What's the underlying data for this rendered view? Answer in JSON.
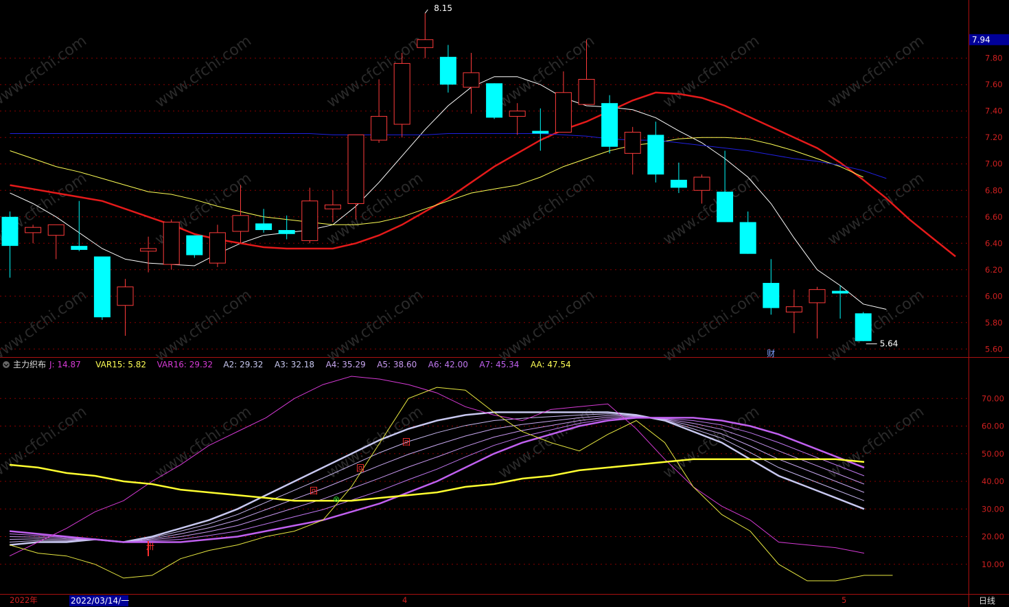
{
  "chart_data": {
    "type": "candlestick",
    "price_axis": {
      "ticks": [
        "7.80",
        "7.60",
        "7.40",
        "7.20",
        "7.00",
        "6.80",
        "6.60",
        "6.40",
        "6.20",
        "6.00",
        "5.80",
        "5.60"
      ],
      "current_price_label": "7.94",
      "ylim": [
        5.56,
        8.24
      ]
    },
    "candles": [
      {
        "o": 6.6,
        "h": 6.64,
        "l": 6.14,
        "c": 6.38
      },
      {
        "o": 6.48,
        "h": 6.54,
        "l": 6.4,
        "c": 6.52
      },
      {
        "o": 6.46,
        "h": 6.54,
        "l": 6.28,
        "c": 6.54
      },
      {
        "o": 6.38,
        "h": 6.72,
        "l": 6.34,
        "c": 6.35
      },
      {
        "o": 6.3,
        "h": 6.3,
        "l": 5.82,
        "c": 5.84
      },
      {
        "o": 5.93,
        "h": 6.13,
        "l": 5.7,
        "c": 6.07
      },
      {
        "o": 6.34,
        "h": 6.45,
        "l": 6.18,
        "c": 6.36
      },
      {
        "o": 6.24,
        "h": 6.58,
        "l": 6.2,
        "c": 6.56
      },
      {
        "o": 6.46,
        "h": 6.46,
        "l": 6.29,
        "c": 6.31
      },
      {
        "o": 6.25,
        "h": 6.54,
        "l": 6.22,
        "c": 6.48
      },
      {
        "o": 6.49,
        "h": 6.84,
        "l": 6.4,
        "c": 6.61
      },
      {
        "o": 6.55,
        "h": 6.66,
        "l": 6.48,
        "c": 6.5
      },
      {
        "o": 6.5,
        "h": 6.61,
        "l": 6.43,
        "c": 6.47
      },
      {
        "o": 6.42,
        "h": 6.82,
        "l": 6.4,
        "c": 6.72
      },
      {
        "o": 6.66,
        "h": 6.8,
        "l": 6.56,
        "c": 6.69
      },
      {
        "o": 6.7,
        "h": 7.22,
        "l": 6.58,
        "c": 7.22
      },
      {
        "o": 7.18,
        "h": 7.64,
        "l": 7.16,
        "c": 7.36
      },
      {
        "o": 7.3,
        "h": 7.84,
        "l": 7.2,
        "c": 7.76
      },
      {
        "o": 7.88,
        "h": 8.14,
        "l": 7.8,
        "c": 7.94
      },
      {
        "o": 7.81,
        "h": 7.9,
        "l": 7.54,
        "c": 7.6
      },
      {
        "o": 7.58,
        "h": 7.84,
        "l": 7.38,
        "c": 7.69
      },
      {
        "o": 7.61,
        "h": 7.61,
        "l": 7.34,
        "c": 7.35
      },
      {
        "o": 7.36,
        "h": 7.46,
        "l": 7.22,
        "c": 7.4
      },
      {
        "o": 7.25,
        "h": 7.42,
        "l": 7.1,
        "c": 7.23
      },
      {
        "o": 7.24,
        "h": 7.7,
        "l": 7.24,
        "c": 7.54
      },
      {
        "o": 7.45,
        "h": 7.94,
        "l": 7.45,
        "c": 7.64
      },
      {
        "o": 7.46,
        "h": 7.52,
        "l": 7.08,
        "c": 7.13
      },
      {
        "o": 7.08,
        "h": 7.28,
        "l": 6.92,
        "c": 7.24
      },
      {
        "o": 7.22,
        "h": 7.32,
        "l": 6.86,
        "c": 6.92
      },
      {
        "o": 6.88,
        "h": 7.01,
        "l": 6.78,
        "c": 6.82
      },
      {
        "o": 6.8,
        "h": 6.92,
        "l": 6.7,
        "c": 6.9
      },
      {
        "o": 6.79,
        "h": 7.1,
        "l": 6.56,
        "c": 6.56
      },
      {
        "o": 6.56,
        "h": 6.64,
        "l": 6.32,
        "c": 6.32
      },
      {
        "o": 6.1,
        "h": 6.28,
        "l": 5.86,
        "c": 5.91
      },
      {
        "o": 5.88,
        "h": 6.05,
        "l": 5.72,
        "c": 5.92
      },
      {
        "o": 5.95,
        "h": 6.07,
        "l": 5.68,
        "c": 6.05
      },
      {
        "o": 6.04,
        "h": 6.08,
        "l": 5.83,
        "c": 6.02
      },
      {
        "o": 5.87,
        "h": 5.88,
        "l": 5.66,
        "c": 5.66
      }
    ],
    "price_lines": [
      {
        "color": "#ffffff",
        "width": 1,
        "start": 0,
        "values": [
          6.78,
          6.7,
          6.6,
          6.48,
          6.36,
          6.28,
          6.25,
          6.24,
          6.23,
          6.32,
          6.4,
          6.46,
          6.48,
          6.5,
          6.54,
          6.68,
          6.86,
          7.06,
          7.26,
          7.44,
          7.58,
          7.66,
          7.66,
          7.6,
          7.5,
          7.44,
          7.43,
          7.41,
          7.35,
          7.25,
          7.16,
          7.04,
          6.9,
          6.7,
          6.44,
          6.2,
          6.08,
          5.94,
          5.9
        ]
      },
      {
        "color": "#e51a1a",
        "width": 2.5,
        "start": 0,
        "values": [
          6.84,
          6.81,
          6.78,
          6.75,
          6.72,
          6.66,
          6.6,
          6.54,
          6.47,
          6.43,
          6.4,
          6.37,
          6.36,
          6.36,
          6.36,
          6.4,
          6.46,
          6.54,
          6.64,
          6.74,
          6.86,
          6.98,
          7.08,
          7.18,
          7.26,
          7.32,
          7.4,
          7.48,
          7.54,
          7.53,
          7.5,
          7.44,
          7.36,
          7.28,
          7.2,
          7.12,
          7.01,
          6.88,
          6.74,
          6.58,
          6.44,
          6.3
        ]
      },
      {
        "color": "#ffff55",
        "width": 1,
        "start": 0,
        "values": [
          7.1,
          7.04,
          6.98,
          6.94,
          6.89,
          6.84,
          6.79,
          6.77,
          6.73,
          6.68,
          6.64,
          6.6,
          6.58,
          6.56,
          6.54,
          6.54,
          6.56,
          6.6,
          6.66,
          6.72,
          6.78,
          6.81,
          6.84,
          6.9,
          6.98,
          7.04,
          7.1,
          7.14,
          7.16,
          7.19,
          7.2,
          7.2,
          7.19,
          7.15,
          7.1,
          7.04,
          6.98,
          6.9
        ]
      },
      {
        "color": "#2020e0",
        "width": 1,
        "start": 0,
        "values": [
          7.23,
          7.23,
          7.23,
          7.23,
          7.23,
          7.23,
          7.23,
          7.23,
          7.23,
          7.23,
          7.23,
          7.23,
          7.23,
          7.23,
          7.22,
          7.22,
          7.22,
          7.22,
          7.22,
          7.23,
          7.23,
          7.23,
          7.23,
          7.23,
          7.22,
          7.21,
          7.19,
          7.18,
          7.18,
          7.16,
          7.14,
          7.12,
          7.1,
          7.07,
          7.04,
          7.02,
          6.99,
          6.95,
          6.89
        ]
      }
    ],
    "annotations": {
      "high": "8.15",
      "low": "5.64",
      "cai_marker": "财"
    },
    "indicator": {
      "name": "主力织布",
      "ylim": [
        0,
        80
      ],
      "ticks": [
        "70.00",
        "60.00",
        "50.00",
        "40.00",
        "30.00",
        "20.00",
        "10.00"
      ],
      "legend": [
        {
          "label": "J",
          "value": "14.87",
          "color": "#d63ad6"
        },
        {
          "label": "VAR15",
          "value": "5.82",
          "color": "#ffff55"
        },
        {
          "label": "VAR16",
          "value": "29.32",
          "color": "#d63ad6"
        },
        {
          "label": "A2",
          "value": "29.32",
          "color": "#c8c8f0"
        },
        {
          "label": "A3",
          "value": "32.18",
          "color": "#c8c8f0"
        },
        {
          "label": "A4",
          "value": "35.29",
          "color": "#c8a8f0"
        },
        {
          "label": "A5",
          "value": "38.60",
          "color": "#c898f0"
        },
        {
          "label": "A6",
          "value": "42.00",
          "color": "#c078f0"
        },
        {
          "label": "A7",
          "value": "45.34",
          "color": "#c060f0"
        },
        {
          "label": "AA",
          "value": "47.54",
          "color": "#ffff55"
        }
      ],
      "series": {
        "J": [
          13,
          18,
          23,
          29,
          33,
          40,
          46,
          53,
          58,
          63,
          70,
          75,
          78,
          77,
          75,
          72,
          67,
          64,
          62,
          66,
          67,
          68,
          59,
          48,
          38,
          31,
          26,
          18,
          17,
          16,
          14
        ],
        "VAR15": [
          17,
          14,
          13,
          10,
          5,
          6,
          12,
          15,
          17,
          20,
          22,
          26,
          38,
          54,
          70,
          74,
          73,
          65,
          58,
          54,
          51,
          57,
          62,
          54,
          38,
          28,
          22,
          10,
          4,
          4,
          6,
          6
        ],
        "A2": [
          17,
          18,
          18,
          19,
          18,
          20,
          23,
          26,
          30,
          35,
          40,
          45,
          50,
          55,
          59,
          62,
          64,
          65,
          65,
          65,
          65,
          65,
          64,
          62,
          58,
          54,
          48,
          42,
          38,
          34,
          30
        ],
        "A7": [
          22,
          21,
          20,
          19,
          18,
          18,
          18,
          19,
          20,
          22,
          24,
          26,
          29,
          32,
          36,
          40,
          45,
          50,
          54,
          57,
          60,
          62,
          63,
          63,
          63,
          62,
          60,
          57,
          53,
          49,
          45
        ],
        "AA": [
          46,
          45,
          43,
          42,
          40,
          39,
          37,
          36,
          35,
          34,
          33,
          33,
          33,
          34,
          35,
          36,
          38,
          39,
          41,
          42,
          44,
          45,
          46,
          47,
          48,
          48,
          48,
          48,
          48,
          48,
          47
        ]
      },
      "markers": [
        {
          "char": "卅",
          "color": "#ff3030"
        },
        {
          "char": "⊗",
          "color": "#30d030"
        },
        {
          "char": "回",
          "color": "#ff3030"
        },
        {
          "char": "回",
          "color": "#ff3030"
        },
        {
          "char": "回",
          "color": "#ff3030"
        }
      ]
    },
    "x_axis": {
      "labels": [
        "2022年",
        "4",
        "5"
      ],
      "cursor_date": "2022/03/14/一",
      "period": "日线"
    },
    "watermark": "www.cfchi.com"
  },
  "colors": {
    "up": "#ff3b3b",
    "down": "#00ffff",
    "grid": "#8b0000",
    "axis_text": "#d02020",
    "price_box": "#000099"
  }
}
